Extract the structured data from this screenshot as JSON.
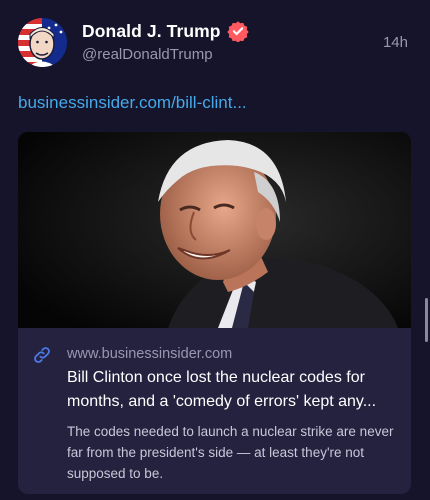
{
  "author": {
    "display_name": "Donald J. Trump",
    "handle": "@realDonaldTrump",
    "verified": true,
    "verified_color": "#ff5a5f"
  },
  "post": {
    "timestamp": "14h",
    "link_text": "businessinsider.com/bill-clint..."
  },
  "card": {
    "image_alt": "Bill Clinton smiling",
    "domain": "www.businessinsider.com",
    "title": "Bill Clinton once lost the nuclear codes for months, and a 'comedy of errors' kept any...",
    "description": "The codes needed to launch a nuclear strike are never far from the president's side — at least they're not supposed to be."
  },
  "colors": {
    "background": "#16142a",
    "card_background": "#24223f",
    "link": "#45a9ea",
    "muted_text": "#9a97b0"
  },
  "icons": {
    "verified": "verified-badge-icon",
    "link": "chain-link-icon"
  }
}
